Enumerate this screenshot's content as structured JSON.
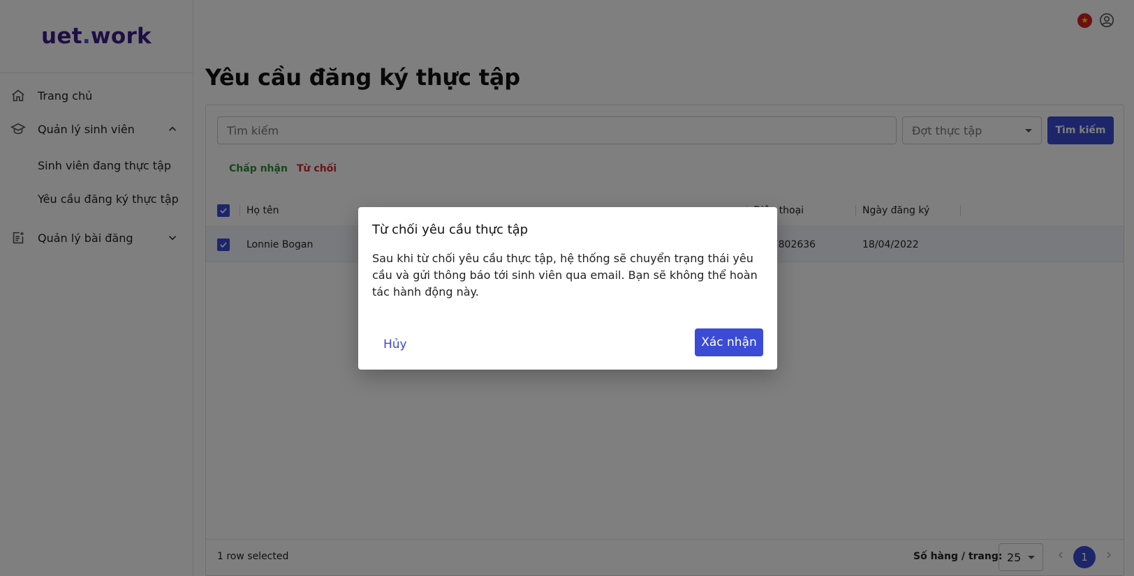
{
  "app": {
    "logo_main": "uet",
    "logo_dot": ".",
    "logo_tail": "work"
  },
  "sidebar": {
    "items": [
      {
        "label": "Trang chủ",
        "icon": "home-icon"
      },
      {
        "label": "Quản lý sinh viên",
        "icon": "graduation-cap-icon",
        "expanded": true
      },
      {
        "label": "Quản lý bài đăng",
        "icon": "post-add-icon",
        "expanded": false
      }
    ],
    "sub_items": [
      "Sinh viên đang thực tập",
      "Yêu cầu đăng ký thực tập"
    ]
  },
  "header": {
    "flag_symbol": "★",
    "language": "vietnam-flag-icon",
    "user": "account-circle-icon"
  },
  "main": {
    "title": "Yêu cầu đăng ký thực tập",
    "search_placeholder": "Tìm kiếm",
    "period_placeholder": "Đợt thực tập",
    "search_button": "Tìm kiếm",
    "accept_label": "Chấp nhận",
    "reject_label": "Từ chối",
    "columns": {
      "name": "Họ tên",
      "phone": "Điện thoại",
      "date": "Ngày đăng ký"
    },
    "rows": [
      {
        "name": "Lonnie Bogan",
        "phone": "0167802636",
        "date": "18/04/2022",
        "selected": true
      }
    ],
    "rows_selected": "1 row selected",
    "per_page_label": "Số hàng / trang:",
    "per_page": "25",
    "page": "1"
  },
  "dialog": {
    "title": "Từ chối yêu cầu thực tập",
    "body": "Sau khi từ chối yêu cầu thực tập, hệ thống sẽ chuyển trạng thái yêu cầu và gửi thông báo tới sinh viên qua email. Bạn sẽ không thể hoàn tác hành động này.",
    "cancel": "Hủy",
    "confirm": "Xác nhận"
  },
  "colors": {
    "accent": "#3b4bd6",
    "logo": "#3a1e88",
    "accept": "#2f8d3a",
    "reject": "#d3262f"
  }
}
